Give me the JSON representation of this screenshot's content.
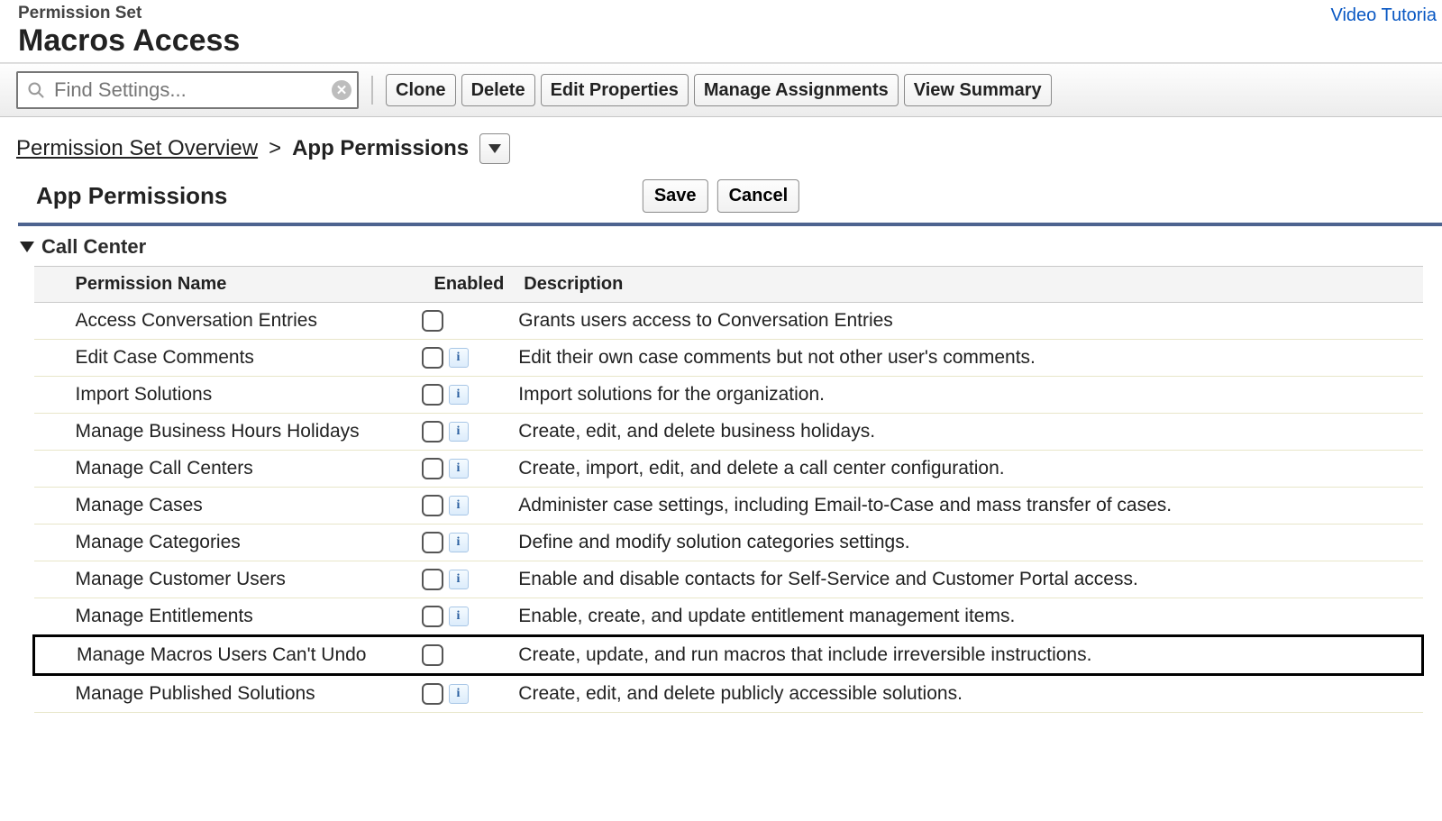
{
  "header": {
    "page_type": "Permission Set",
    "title": "Macros Access",
    "video_link": "Video Tutoria"
  },
  "toolbar": {
    "search_placeholder": "Find Settings...",
    "buttons": {
      "clone": "Clone",
      "delete": "Delete",
      "edit_properties": "Edit Properties",
      "manage_assignments": "Manage Assignments",
      "view_summary": "View Summary"
    }
  },
  "breadcrumb": {
    "root": "Permission Set Overview",
    "current": "App Permissions"
  },
  "section": {
    "title": "App Permissions",
    "save": "Save",
    "cancel": "Cancel"
  },
  "group": {
    "title": "Call Center"
  },
  "table": {
    "headers": {
      "name": "Permission Name",
      "enabled": "Enabled",
      "description": "Description"
    },
    "rows": [
      {
        "name": "Access Conversation Entries",
        "has_info": false,
        "enabled": false,
        "description": "Grants users access to Conversation Entries",
        "highlight": false
      },
      {
        "name": "Edit Case Comments",
        "has_info": true,
        "enabled": false,
        "description": "Edit their own case comments but not other user's comments.",
        "highlight": false
      },
      {
        "name": "Import Solutions",
        "has_info": true,
        "enabled": false,
        "description": "Import solutions for the organization.",
        "highlight": false
      },
      {
        "name": "Manage Business Hours Holidays",
        "has_info": true,
        "enabled": false,
        "description": "Create, edit, and delete business holidays.",
        "highlight": false
      },
      {
        "name": "Manage Call Centers",
        "has_info": true,
        "enabled": false,
        "description": "Create, import, edit, and delete a call center configuration.",
        "highlight": false
      },
      {
        "name": "Manage Cases",
        "has_info": true,
        "enabled": false,
        "description": "Administer case settings, including Email-to-Case and mass transfer of cases.",
        "highlight": false
      },
      {
        "name": "Manage Categories",
        "has_info": true,
        "enabled": false,
        "description": "Define and modify solution categories settings.",
        "highlight": false
      },
      {
        "name": "Manage Customer Users",
        "has_info": true,
        "enabled": false,
        "description": "Enable and disable contacts for Self-Service and Customer Portal access.",
        "highlight": false
      },
      {
        "name": "Manage Entitlements",
        "has_info": true,
        "enabled": false,
        "description": "Enable, create, and update entitlement management items.",
        "highlight": false
      },
      {
        "name": "Manage Macros Users Can't Undo",
        "has_info": false,
        "enabled": false,
        "description": "Create, update, and run macros that include irreversible instructions.",
        "highlight": true
      },
      {
        "name": "Manage Published Solutions",
        "has_info": true,
        "enabled": false,
        "description": "Create, edit, and delete publicly accessible solutions.",
        "highlight": false
      }
    ]
  }
}
